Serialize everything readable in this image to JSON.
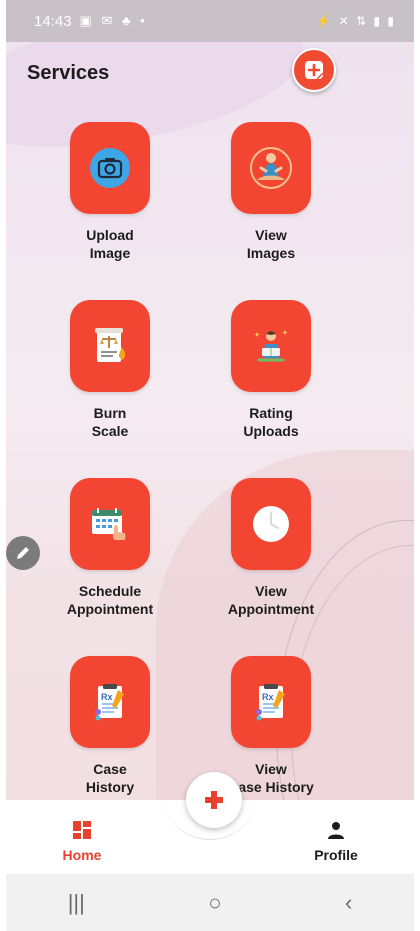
{
  "status_bar": {
    "time": "14:43",
    "left_icons": "▣ ✉ ♣ •",
    "right_icons": "⚡ ✕ ⇅ ▮ ▮"
  },
  "page": {
    "title": "Services"
  },
  "colors": {
    "accent": "#f24632",
    "nav_active": "#e8412f"
  },
  "services": [
    {
      "label": "Upload\nImage",
      "icon": "camera-icon"
    },
    {
      "label": "View\nImages",
      "icon": "meditation-icon"
    },
    {
      "label": "Burn\nScale",
      "icon": "scale-document-icon"
    },
    {
      "label": "Rating\nUploads",
      "icon": "reading-person-icon"
    },
    {
      "label": "Schedule\nAppointment",
      "icon": "calendar-icon"
    },
    {
      "label": "View\nAppointment",
      "icon": "clock-icon"
    },
    {
      "label": "Case\nHistory",
      "icon": "prescription-icon"
    },
    {
      "label": "View\nCase History",
      "icon": "prescription-icon"
    }
  ],
  "bottom_nav": {
    "home_label": "Home",
    "profile_label": "Profile"
  }
}
